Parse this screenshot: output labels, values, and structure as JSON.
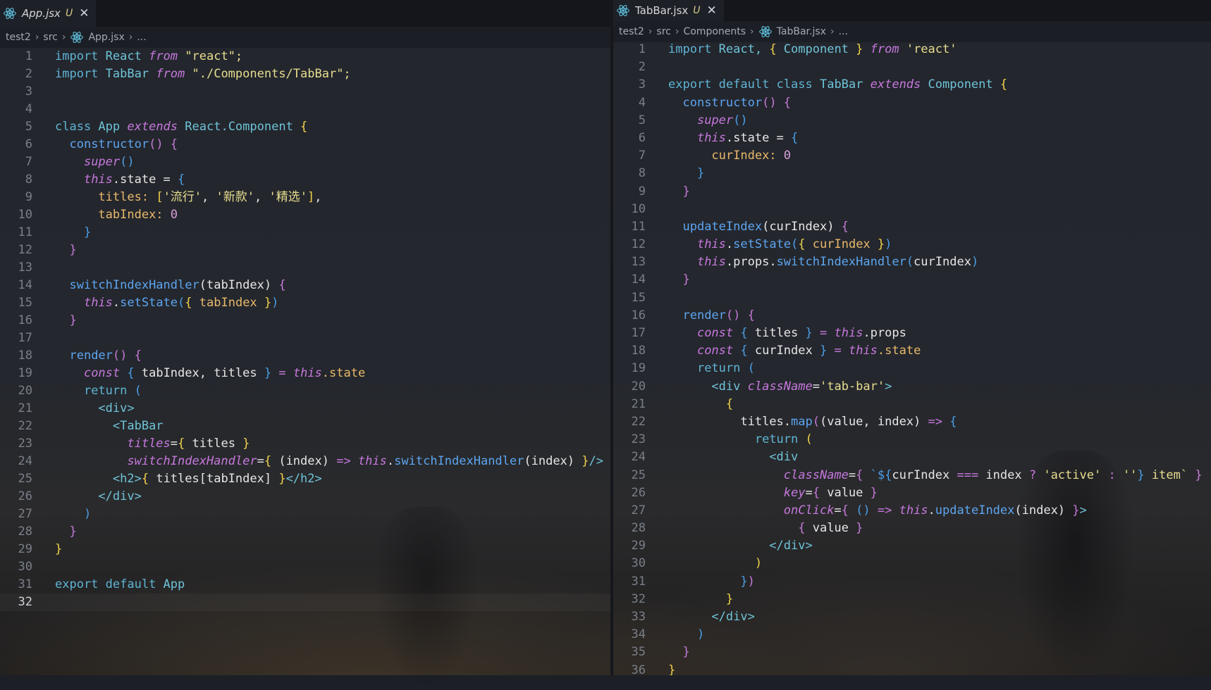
{
  "left_editor": {
    "tab": {
      "filename": "App.jsx",
      "status": "U"
    },
    "breadcrumb": [
      "test2",
      "src",
      "App.jsx",
      "..."
    ],
    "active_line": 32,
    "lines": [
      [
        {
          "t": "import ",
          "c": "kw"
        },
        {
          "t": "React ",
          "c": "cl"
        },
        {
          "t": "from",
          "c": "it"
        },
        {
          "t": " \"react\";",
          "c": "str"
        }
      ],
      [
        {
          "t": "import ",
          "c": "kw"
        },
        {
          "t": "TabBar ",
          "c": "cl"
        },
        {
          "t": "from",
          "c": "it"
        },
        {
          "t": " \"./Components/TabBar\";",
          "c": "str"
        }
      ],
      [],
      [],
      [
        {
          "t": "class ",
          "c": "kw"
        },
        {
          "t": "App ",
          "c": "cl"
        },
        {
          "t": "extends ",
          "c": "it"
        },
        {
          "t": "React",
          "c": "cl"
        },
        {
          "t": ".Component ",
          "c": "cl"
        },
        {
          "t": "{",
          "c": "b1"
        }
      ],
      [
        {
          "t": "  "
        },
        {
          "t": "constructor",
          "c": "fn"
        },
        {
          "t": "() ",
          "c": "b2"
        },
        {
          "t": "{",
          "c": "b2"
        }
      ],
      [
        {
          "t": "    "
        },
        {
          "t": "super",
          "c": "it"
        },
        {
          "t": "()",
          "c": "b3"
        }
      ],
      [
        {
          "t": "    "
        },
        {
          "t": "this",
          "c": "it"
        },
        {
          "t": ".state = "
        },
        {
          "t": "{",
          "c": "b3"
        }
      ],
      [
        {
          "t": "      "
        },
        {
          "t": "titles: ",
          "c": "pr"
        },
        {
          "t": "[",
          "c": "b1"
        },
        {
          "t": "'流行'",
          "c": "str"
        },
        {
          "t": ", "
        },
        {
          "t": "'新款'",
          "c": "str"
        },
        {
          "t": ", "
        },
        {
          "t": "'精选'",
          "c": "str"
        },
        {
          "t": "]",
          "c": "b1"
        },
        {
          "t": ","
        }
      ],
      [
        {
          "t": "      "
        },
        {
          "t": "tabIndex: ",
          "c": "pr"
        },
        {
          "t": "0",
          "c": "num"
        }
      ],
      [
        {
          "t": "    "
        },
        {
          "t": "}",
          "c": "b3"
        }
      ],
      [
        {
          "t": "  "
        },
        {
          "t": "}",
          "c": "b2"
        }
      ],
      [],
      [
        {
          "t": "  "
        },
        {
          "t": "switchIndexHandler",
          "c": "fn"
        },
        {
          "t": "("
        },
        {
          "t": "tabIndex"
        },
        {
          "t": ") "
        },
        {
          "t": "{",
          "c": "b2"
        }
      ],
      [
        {
          "t": "    "
        },
        {
          "t": "this",
          "c": "it"
        },
        {
          "t": ".",
          "c": ""
        },
        {
          "t": "setState",
          "c": "fn"
        },
        {
          "t": "(",
          "c": "b3"
        },
        {
          "t": "{ ",
          "c": "b1"
        },
        {
          "t": "tabIndex ",
          "c": "pr"
        },
        {
          "t": "}",
          "c": "b1"
        },
        {
          "t": ")",
          "c": "b3"
        }
      ],
      [
        {
          "t": "  "
        },
        {
          "t": "}",
          "c": "b2"
        }
      ],
      [],
      [
        {
          "t": "  "
        },
        {
          "t": "render",
          "c": "fn"
        },
        {
          "t": "() ",
          "c": "b2"
        },
        {
          "t": "{",
          "c": "b2"
        }
      ],
      [
        {
          "t": "    "
        },
        {
          "t": "const ",
          "c": "it"
        },
        {
          "t": "{ ",
          "c": "b3"
        },
        {
          "t": "tabIndex, titles "
        },
        {
          "t": "}",
          "c": "b3"
        },
        {
          "t": " = ",
          "c": "op"
        },
        {
          "t": "this",
          "c": "it"
        },
        {
          "t": ".state",
          "c": "pr"
        }
      ],
      [
        {
          "t": "    "
        },
        {
          "t": "return ",
          "c": "kw"
        },
        {
          "t": "(",
          "c": "b3"
        }
      ],
      [
        {
          "t": "      "
        },
        {
          "t": "<div>",
          "c": "tg"
        }
      ],
      [
        {
          "t": "        "
        },
        {
          "t": "<TabBar",
          "c": "tg"
        }
      ],
      [
        {
          "t": "          "
        },
        {
          "t": "titles",
          "c": "it"
        },
        {
          "t": "=",
          "c": ""
        },
        {
          "t": "{ ",
          "c": "b1"
        },
        {
          "t": "titles "
        },
        {
          "t": "}",
          "c": "b1"
        }
      ],
      [
        {
          "t": "          "
        },
        {
          "t": "switchIndexHandler",
          "c": "it"
        },
        {
          "t": "="
        },
        {
          "t": "{ ",
          "c": "b1"
        },
        {
          "t": "(index) "
        },
        {
          "t": "=> ",
          "c": "op"
        },
        {
          "t": "this",
          "c": "it"
        },
        {
          "t": ".",
          "c": ""
        },
        {
          "t": "switchIndexHandler",
          "c": "fn"
        },
        {
          "t": "(index) "
        },
        {
          "t": "}",
          "c": "b1"
        },
        {
          "t": "/>",
          "c": "tg"
        }
      ],
      [
        {
          "t": "        "
        },
        {
          "t": "<h2>",
          "c": "tg"
        },
        {
          "t": "{ ",
          "c": "b1"
        },
        {
          "t": "titles[tabIndex] "
        },
        {
          "t": "}",
          "c": "b1"
        },
        {
          "t": "</h2>",
          "c": "tg"
        }
      ],
      [
        {
          "t": "      "
        },
        {
          "t": "</div>",
          "c": "tg"
        }
      ],
      [
        {
          "t": "    "
        },
        {
          "t": ")",
          "c": "b3"
        }
      ],
      [
        {
          "t": "  "
        },
        {
          "t": "}",
          "c": "b2"
        }
      ],
      [
        {
          "t": "}",
          "c": "b1"
        }
      ],
      [],
      [
        {
          "t": "export ",
          "c": "kw"
        },
        {
          "t": "default ",
          "c": "kw"
        },
        {
          "t": "App",
          "c": "cl"
        }
      ],
      []
    ]
  },
  "right_editor": {
    "tab": {
      "filename": "TabBar.jsx",
      "status": "U"
    },
    "breadcrumb": [
      "test2",
      "src",
      "Components",
      "TabBar.jsx",
      "..."
    ],
    "active_line": 0,
    "lines": [
      [
        {
          "t": "import ",
          "c": "kw"
        },
        {
          "t": "React, ",
          "c": "cl"
        },
        {
          "t": "{ ",
          "c": "b1"
        },
        {
          "t": "Component ",
          "c": "cl"
        },
        {
          "t": "} ",
          "c": "b1"
        },
        {
          "t": "from",
          "c": "it"
        },
        {
          "t": " 'react'",
          "c": "str"
        }
      ],
      [],
      [
        {
          "t": "export ",
          "c": "kw"
        },
        {
          "t": "default ",
          "c": "kw"
        },
        {
          "t": "class ",
          "c": "kw"
        },
        {
          "t": "TabBar ",
          "c": "cl"
        },
        {
          "t": "extends ",
          "c": "it"
        },
        {
          "t": "Component ",
          "c": "cl"
        },
        {
          "t": "{",
          "c": "b1"
        }
      ],
      [
        {
          "t": "  "
        },
        {
          "t": "constructor",
          "c": "fn"
        },
        {
          "t": "() ",
          "c": "b2"
        },
        {
          "t": "{",
          "c": "b2"
        }
      ],
      [
        {
          "t": "    "
        },
        {
          "t": "super",
          "c": "it"
        },
        {
          "t": "()",
          "c": "b3"
        }
      ],
      [
        {
          "t": "    "
        },
        {
          "t": "this",
          "c": "it"
        },
        {
          "t": ".state = "
        },
        {
          "t": "{",
          "c": "b3"
        }
      ],
      [
        {
          "t": "      "
        },
        {
          "t": "curIndex: ",
          "c": "pr"
        },
        {
          "t": "0",
          "c": "num"
        }
      ],
      [
        {
          "t": "    "
        },
        {
          "t": "}",
          "c": "b3"
        }
      ],
      [
        {
          "t": "  "
        },
        {
          "t": "}",
          "c": "b2"
        }
      ],
      [],
      [
        {
          "t": "  "
        },
        {
          "t": "updateIndex",
          "c": "fn"
        },
        {
          "t": "(curIndex) "
        },
        {
          "t": "{",
          "c": "b2"
        }
      ],
      [
        {
          "t": "    "
        },
        {
          "t": "this",
          "c": "it"
        },
        {
          "t": "."
        },
        {
          "t": "setState",
          "c": "fn"
        },
        {
          "t": "(",
          "c": "b3"
        },
        {
          "t": "{ ",
          "c": "b1"
        },
        {
          "t": "curIndex ",
          "c": "pr"
        },
        {
          "t": "}",
          "c": "b1"
        },
        {
          "t": ")",
          "c": "b3"
        }
      ],
      [
        {
          "t": "    "
        },
        {
          "t": "this",
          "c": "it"
        },
        {
          "t": ".props."
        },
        {
          "t": "switchIndexHandler",
          "c": "fn"
        },
        {
          "t": "(",
          "c": "b3"
        },
        {
          "t": "curIndex"
        },
        {
          "t": ")",
          "c": "b3"
        }
      ],
      [
        {
          "t": "  "
        },
        {
          "t": "}",
          "c": "b2"
        }
      ],
      [],
      [
        {
          "t": "  "
        },
        {
          "t": "render",
          "c": "fn"
        },
        {
          "t": "() ",
          "c": "b2"
        },
        {
          "t": "{",
          "c": "b2"
        }
      ],
      [
        {
          "t": "    "
        },
        {
          "t": "const ",
          "c": "it"
        },
        {
          "t": "{ ",
          "c": "b3"
        },
        {
          "t": "titles "
        },
        {
          "t": "}",
          "c": "b3"
        },
        {
          "t": " = ",
          "c": "op"
        },
        {
          "t": "this",
          "c": "it"
        },
        {
          "t": ".props"
        }
      ],
      [
        {
          "t": "    "
        },
        {
          "t": "const ",
          "c": "it"
        },
        {
          "t": "{ ",
          "c": "b3"
        },
        {
          "t": "curIndex "
        },
        {
          "t": "}",
          "c": "b3"
        },
        {
          "t": " = ",
          "c": "op"
        },
        {
          "t": "this",
          "c": "it"
        },
        {
          "t": ".state",
          "c": "pr"
        }
      ],
      [
        {
          "t": "    "
        },
        {
          "t": "return ",
          "c": "kw"
        },
        {
          "t": "(",
          "c": "b3"
        }
      ],
      [
        {
          "t": "      "
        },
        {
          "t": "<div ",
          "c": "tg"
        },
        {
          "t": "className",
          "c": "it"
        },
        {
          "t": "="
        },
        {
          "t": "'tab-bar'",
          "c": "str"
        },
        {
          "t": ">",
          "c": "tg"
        }
      ],
      [
        {
          "t": "        "
        },
        {
          "t": "{",
          "c": "b1"
        }
      ],
      [
        {
          "t": "          "
        },
        {
          "t": "titles."
        },
        {
          "t": "map",
          "c": "fn"
        },
        {
          "t": "(",
          "c": "b2"
        },
        {
          "t": "(value, index) "
        },
        {
          "t": "=> ",
          "c": "op"
        },
        {
          "t": "{",
          "c": "b3"
        }
      ],
      [
        {
          "t": "            "
        },
        {
          "t": "return ",
          "c": "kw"
        },
        {
          "t": "(",
          "c": "b1"
        }
      ],
      [
        {
          "t": "              "
        },
        {
          "t": "<div",
          "c": "tg"
        }
      ],
      [
        {
          "t": "                "
        },
        {
          "t": "className",
          "c": "it"
        },
        {
          "t": "="
        },
        {
          "t": "{ ",
          "c": "b2"
        },
        {
          "t": "`${",
          "c": "b3"
        },
        {
          "t": "curIndex "
        },
        {
          "t": "=== ",
          "c": "op"
        },
        {
          "t": "index "
        },
        {
          "t": "? ",
          "c": "op"
        },
        {
          "t": "'active'",
          "c": "str"
        },
        {
          "t": " : ",
          "c": "op"
        },
        {
          "t": "''",
          "c": "str"
        },
        {
          "t": "}",
          "c": "b3"
        },
        {
          "t": " item` ",
          "c": "str"
        },
        {
          "t": "}",
          "c": "b2"
        }
      ],
      [
        {
          "t": "                "
        },
        {
          "t": "key",
          "c": "it"
        },
        {
          "t": "="
        },
        {
          "t": "{ ",
          "c": "b2"
        },
        {
          "t": "value "
        },
        {
          "t": "}",
          "c": "b2"
        }
      ],
      [
        {
          "t": "                "
        },
        {
          "t": "onClick",
          "c": "it"
        },
        {
          "t": "="
        },
        {
          "t": "{ ",
          "c": "b2"
        },
        {
          "t": "() ",
          "c": "b3"
        },
        {
          "t": "=> ",
          "c": "op"
        },
        {
          "t": "this",
          "c": "it"
        },
        {
          "t": "."
        },
        {
          "t": "updateIndex",
          "c": "fn"
        },
        {
          "t": "(index) "
        },
        {
          "t": "}",
          "c": "b2"
        },
        {
          "t": ">",
          "c": "tg"
        }
      ],
      [
        {
          "t": "                  "
        },
        {
          "t": "{ ",
          "c": "b2"
        },
        {
          "t": "value "
        },
        {
          "t": "}",
          "c": "b2"
        }
      ],
      [
        {
          "t": "              "
        },
        {
          "t": "</div>",
          "c": "tg"
        }
      ],
      [
        {
          "t": "            "
        },
        {
          "t": ")",
          "c": "b1"
        }
      ],
      [
        {
          "t": "          "
        },
        {
          "t": "}",
          "c": "b3"
        },
        {
          "t": ")",
          "c": "b2"
        }
      ],
      [
        {
          "t": "        "
        },
        {
          "t": "}",
          "c": "b1"
        }
      ],
      [
        {
          "t": "      "
        },
        {
          "t": "</div>",
          "c": "tg"
        }
      ],
      [
        {
          "t": "    "
        },
        {
          "t": ")",
          "c": "b3"
        }
      ],
      [
        {
          "t": "  "
        },
        {
          "t": "}",
          "c": "b2"
        }
      ],
      [
        {
          "t": "}",
          "c": "b1"
        }
      ]
    ]
  },
  "colors": {
    "keyword": "#5fb4d4",
    "italic_keyword": "#c678dd",
    "class_name": "#6ec3d8",
    "function": "#5da5f0",
    "string": "#e7dd8e",
    "number": "#d89fd8",
    "property": "#e8b96b",
    "bracket_gold": "#f2d34b",
    "bracket_purple": "#c57ad8",
    "bracket_blue": "#4a9fe8",
    "tab_modified": "#d9c98a"
  },
  "icons": {
    "file_icon": "react-icon",
    "close": "close-icon",
    "breadcrumb_sep": "chevron-right-icon"
  }
}
